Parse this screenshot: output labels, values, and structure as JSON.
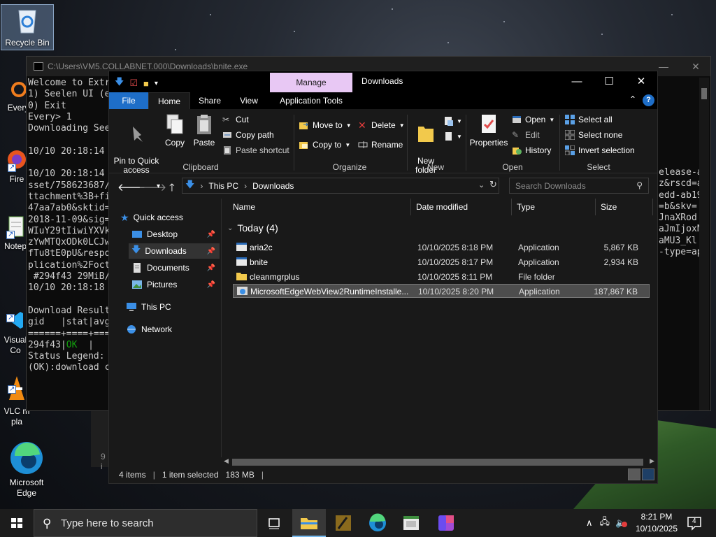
{
  "desktop": {
    "icons": [
      {
        "label": "Recycle Bin"
      },
      {
        "label": "Every"
      },
      {
        "label": "Fire"
      },
      {
        "label": "Notep"
      },
      {
        "label": "Visual\nCo"
      },
      {
        "label": "VLC m\npla"
      },
      {
        "label": "Microsoft\nEdge"
      }
    ]
  },
  "console": {
    "title": "C:\\Users\\VM5.COLLABNET.000\\Downloads\\bnite.exe",
    "left_lines": "Welcome to Extr\n1) Seelen UI (e\n0) Exit\nEvery> 1\nDownloading See\n\n10/10 20:18:14\n\n10/10 20:18:14\nsset/758623687/\nttachment%3B+fi\n47aa7ab0&sktid=\n2018-11-09&sig=\nWIuY29tIiwiYXVk\nzYwMTQxODk0LCJw\nfTu8tE0pU&respo\nplication%2Foct\n #294f43 29MiB/\n10/10 20:18:18\n\nDownload Result\ngid   |stat|avg\n======+====+===\n294f43|",
    "ok_text": "OK",
    "ok_suffix": "  |",
    "legend_lines": "\nStatus Legend:\n(OK):download c",
    "right_lines": "elease-a\nz&rscd=a\nedd-ab19\n=b&skv=\nJnaXRod\naJmIjoxN\naMU3_Kl\n-type=ap",
    "stub_text": "9 i"
  },
  "explorer": {
    "window_title": "Downloads",
    "manage_tab": "Manage",
    "tabs": {
      "file": "File",
      "home": "Home",
      "share": "Share",
      "view": "View",
      "app_tools": "Application Tools"
    },
    "ribbon": {
      "clipboard": {
        "pin": "Pin to Quick\naccess",
        "copy": "Copy",
        "paste": "Paste",
        "cut": "Cut",
        "copy_path": "Copy path",
        "paste_shortcut": "Paste shortcut",
        "label": "Clipboard"
      },
      "organize": {
        "move_to": "Move to",
        "copy_to": "Copy to",
        "delete": "Delete",
        "rename": "Rename",
        "label": "Organize"
      },
      "new": {
        "new_folder": "New\nfolder",
        "label": "New"
      },
      "open": {
        "properties": "Properties",
        "open": "Open",
        "edit": "Edit",
        "history": "History",
        "label": "Open"
      },
      "select": {
        "select_all": "Select all",
        "select_none": "Select none",
        "invert": "Invert selection",
        "label": "Select"
      }
    },
    "address": {
      "crumbs": [
        "This PC",
        "Downloads"
      ],
      "search_placeholder": "Search Downloads"
    },
    "nav": {
      "quick_access": "Quick access",
      "desktop": "Desktop",
      "downloads": "Downloads",
      "documents": "Documents",
      "pictures": "Pictures",
      "this_pc": "This PC",
      "network": "Network"
    },
    "columns": {
      "name": "Name",
      "date": "Date modified",
      "type": "Type",
      "size": "Size"
    },
    "group_label": "Today (4)",
    "files": [
      {
        "name": "aria2c",
        "date": "10/10/2025 8:18 PM",
        "type": "Application",
        "size": "5,867 KB",
        "kind": "app"
      },
      {
        "name": "bnite",
        "date": "10/10/2025 8:17 PM",
        "type": "Application",
        "size": "2,934 KB",
        "kind": "app"
      },
      {
        "name": "cleanmgrplus",
        "date": "10/10/2025 8:11 PM",
        "type": "File folder",
        "size": "",
        "kind": "folder"
      },
      {
        "name": "MicrosoftEdgeWebView2RuntimeInstalle...",
        "date": "10/10/2025 8:20 PM",
        "type": "Application",
        "size": "187,867 KB",
        "kind": "installer",
        "selected": true
      }
    ],
    "status": {
      "items": "4 items",
      "selected": "1 item selected",
      "size": "183 MB"
    }
  },
  "taskbar": {
    "search_placeholder": "Type here to search",
    "time": "8:21 PM",
    "date": "10/10/2025",
    "notification_count": "4"
  },
  "colors": {
    "accent": "#1e6ec8",
    "manage_tab": "#e8c8f4",
    "ok_green": "#13a10e"
  }
}
